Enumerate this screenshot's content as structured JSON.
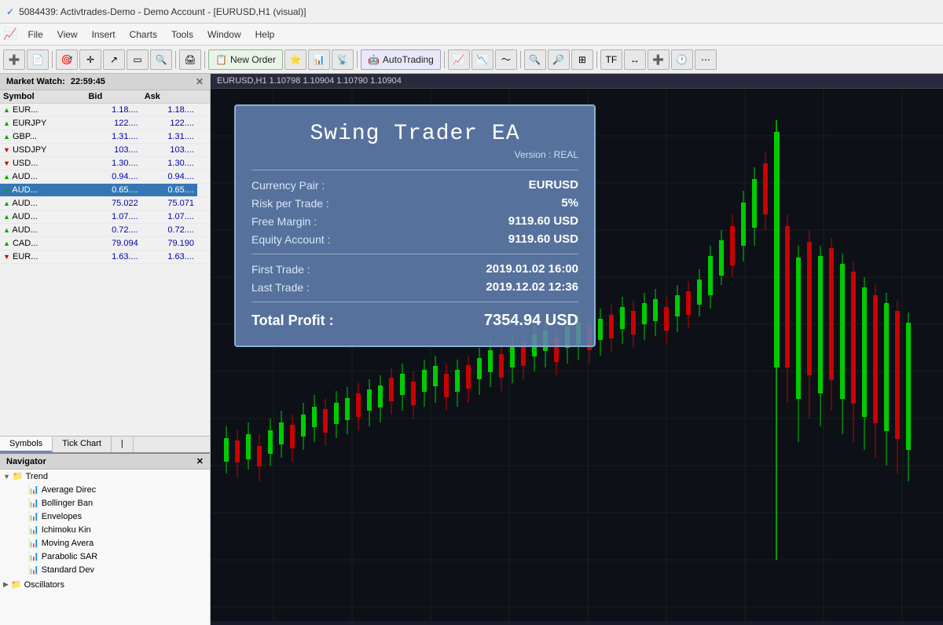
{
  "titlebar": {
    "title": "5084439: Activtrades-Demo - Demo Account - [EURUSD,H1 (visual)]"
  },
  "menubar": {
    "icon_label": "✓",
    "items": [
      {
        "label": "File"
      },
      {
        "label": "View"
      },
      {
        "label": "Insert"
      },
      {
        "label": "Charts"
      },
      {
        "label": "Tools"
      },
      {
        "label": "Window"
      },
      {
        "label": "Help"
      }
    ]
  },
  "toolbar": {
    "new_order_label": "New Order",
    "autotrading_label": "AutoTrading"
  },
  "market_watch": {
    "title": "Market Watch:",
    "time": "22:59:45",
    "columns": [
      "Symbol",
      "Bid",
      "Ask"
    ],
    "rows": [
      {
        "symbol": "EUR...",
        "bid": "1.18....",
        "ask": "1.18....",
        "direction": "up"
      },
      {
        "symbol": "EURJPY",
        "bid": "122....",
        "ask": "122....",
        "direction": "up"
      },
      {
        "symbol": "GBP...",
        "bid": "1.31....",
        "ask": "1.31....",
        "direction": "up"
      },
      {
        "symbol": "USDJPY",
        "bid": "103....",
        "ask": "103....",
        "direction": "down"
      },
      {
        "symbol": "USD...",
        "bid": "1.30....",
        "ask": "1.30....",
        "direction": "down"
      },
      {
        "symbol": "AUD...",
        "bid": "0.94....",
        "ask": "0.94....",
        "direction": "up"
      },
      {
        "symbol": "AUD...",
        "bid": "0.65....",
        "ask": "0.65....",
        "direction": "up",
        "selected": true
      },
      {
        "symbol": "AUD...",
        "bid": "75.022",
        "ask": "75.071",
        "direction": "up"
      },
      {
        "symbol": "AUD...",
        "bid": "1.07....",
        "ask": "1.07....",
        "direction": "up"
      },
      {
        "symbol": "AUD...",
        "bid": "0.72....",
        "ask": "0.72....",
        "direction": "up"
      },
      {
        "symbol": "CAD...",
        "bid": "79.094",
        "ask": "79.190",
        "direction": "up"
      },
      {
        "symbol": "EUR...",
        "bid": "1.63....",
        "ask": "1.63....",
        "direction": "down"
      }
    ],
    "tabs": [
      "Symbols",
      "Tick Chart",
      "|"
    ]
  },
  "navigator": {
    "title": "Navigator",
    "tree": {
      "label": "Trend",
      "expanded": true,
      "children": [
        {
          "label": "Average Direc"
        },
        {
          "label": "Bollinger Ban"
        },
        {
          "label": "Envelopes"
        },
        {
          "label": "Ichimoku Kin"
        },
        {
          "label": "Moving Avera"
        },
        {
          "label": "Parabolic SAR"
        },
        {
          "label": "Standard Dev"
        }
      ]
    },
    "section2": "Oscillators"
  },
  "chart": {
    "header": "EURUSD,H1  1.10798  1.10904  1.10790  1.10904"
  },
  "ea_panel": {
    "title": "Swing Trader EA",
    "version": "Version : REAL",
    "currency_pair_label": "Currency Pair :",
    "currency_pair_value": "EURUSD",
    "risk_label": "Risk per Trade :",
    "risk_value": "5%",
    "free_margin_label": "Free Margin :",
    "free_margin_value": "9119.60 USD",
    "equity_label": "Equity Account :",
    "equity_value": "9119.60 USD",
    "first_trade_label": "First Trade :",
    "first_trade_value": "2019.01.02 16:00",
    "last_trade_label": "Last Trade :",
    "last_trade_value": "2019.12.02 12:36",
    "total_profit_label": "Total Profit :",
    "total_profit_value": "7354.94 USD"
  },
  "colors": {
    "chart_bg": "#0d1117",
    "grid": "#1e2a1e",
    "candle_up": "#00cc00",
    "candle_down": "#cc0000",
    "ea_bg": "rgba(90,120,170,0.85)"
  }
}
